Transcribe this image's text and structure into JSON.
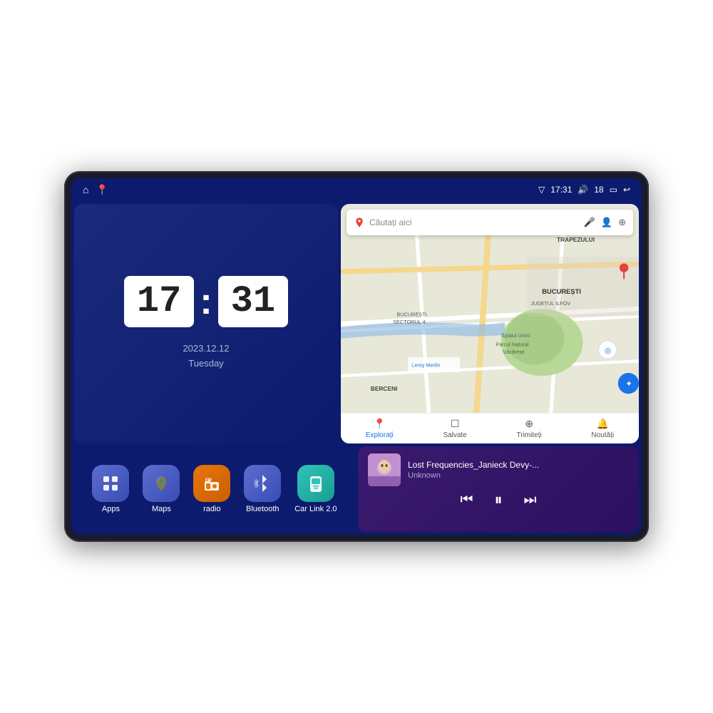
{
  "device": {
    "status_bar": {
      "signal_icon": "▽",
      "time": "17:31",
      "volume_icon": "🔊",
      "volume_level": "18",
      "battery_icon": "▭",
      "back_icon": "↩",
      "home_icon": "⌂",
      "maps_icon": "📍"
    },
    "clock": {
      "hours": "17",
      "minutes": "31",
      "date": "2023.12.12",
      "day": "Tuesday"
    },
    "map": {
      "search_placeholder": "Căutați aici",
      "nav_items": [
        {
          "label": "Explorați",
          "icon": "📍",
          "active": true
        },
        {
          "label": "Salvate",
          "icon": "☐",
          "active": false
        },
        {
          "label": "Trimiteți",
          "icon": "⊕",
          "active": false
        },
        {
          "label": "Noutăți",
          "icon": "🔔",
          "active": false
        }
      ],
      "labels": {
        "trapezului": "TRAPEZULUI",
        "bucuresti": "BUCUREȘTI",
        "judet_ilfov": "JUDEȚUL ILFOV",
        "berceni": "BERCENI",
        "sectorul4": "BUCUREȘTI\nSECTORUL 4",
        "parcul_natural": "Parcul Natural Văcărești",
        "leroy": "Leroy Merlin"
      }
    },
    "apps": [
      {
        "id": "apps",
        "label": "Apps",
        "icon": "⊞",
        "color_class": "icon-apps"
      },
      {
        "id": "maps",
        "label": "Maps",
        "icon": "📍",
        "color_class": "icon-maps"
      },
      {
        "id": "radio",
        "label": "radio",
        "icon": "📻",
        "color_class": "icon-radio"
      },
      {
        "id": "bluetooth",
        "label": "Bluetooth",
        "icon": "⚡",
        "color_class": "icon-bluetooth"
      },
      {
        "id": "carlink",
        "label": "Car Link 2.0",
        "icon": "📱",
        "color_class": "icon-carlink"
      }
    ],
    "music": {
      "title": "Lost Frequencies_Janieck Devy-...",
      "artist": "Unknown",
      "prev_icon": "⏮",
      "play_icon": "⏸",
      "next_icon": "⏭"
    }
  }
}
